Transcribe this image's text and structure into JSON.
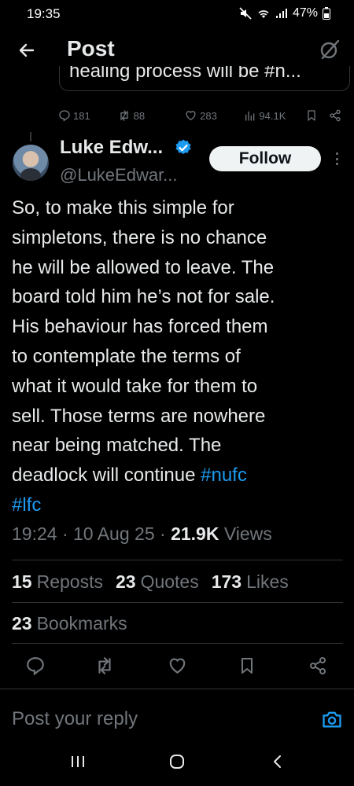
{
  "status_bar": {
    "time": "19:35",
    "battery": "47%"
  },
  "header": {
    "title": "Post"
  },
  "quoted_post": {
    "snippet": "healing process will be #n..."
  },
  "previous_actions": {
    "replies": "181",
    "reposts": "88",
    "likes": "283",
    "views": "94.1K"
  },
  "author": {
    "name": "Luke Edw...",
    "handle": "@LukeEdwar...",
    "follow_label": "Follow"
  },
  "tweet": {
    "lines": [
      "So, to make this simple for",
      "simpletons, there is no chance",
      "he will be allowed to leave. The",
      "board told him he’s not for sale.",
      "His behaviour has forced them",
      "to contemplate the terms of",
      "what it would take for them to",
      "sell. Those terms are nowhere",
      "near being matched. The",
      "deadlock will continue "
    ],
    "hashtag_1": "#nufc",
    "hashtag_2": "#lfc"
  },
  "meta": {
    "time": "19:24",
    "date": "10 Aug 25",
    "views_count": "21.9K",
    "views_label": "Views"
  },
  "stats": {
    "reposts_count": "15",
    "reposts_label": "Reposts",
    "quotes_count": "23",
    "quotes_label": "Quotes",
    "likes_count": "173",
    "likes_label": "Likes",
    "bookmarks_count": "23",
    "bookmarks_label": "Bookmarks"
  },
  "reply": {
    "placeholder": "Post your reply"
  },
  "colors": {
    "accent": "#1d9bf0",
    "muted": "#71767b",
    "text": "#e7e9ea",
    "background": "#000000"
  }
}
